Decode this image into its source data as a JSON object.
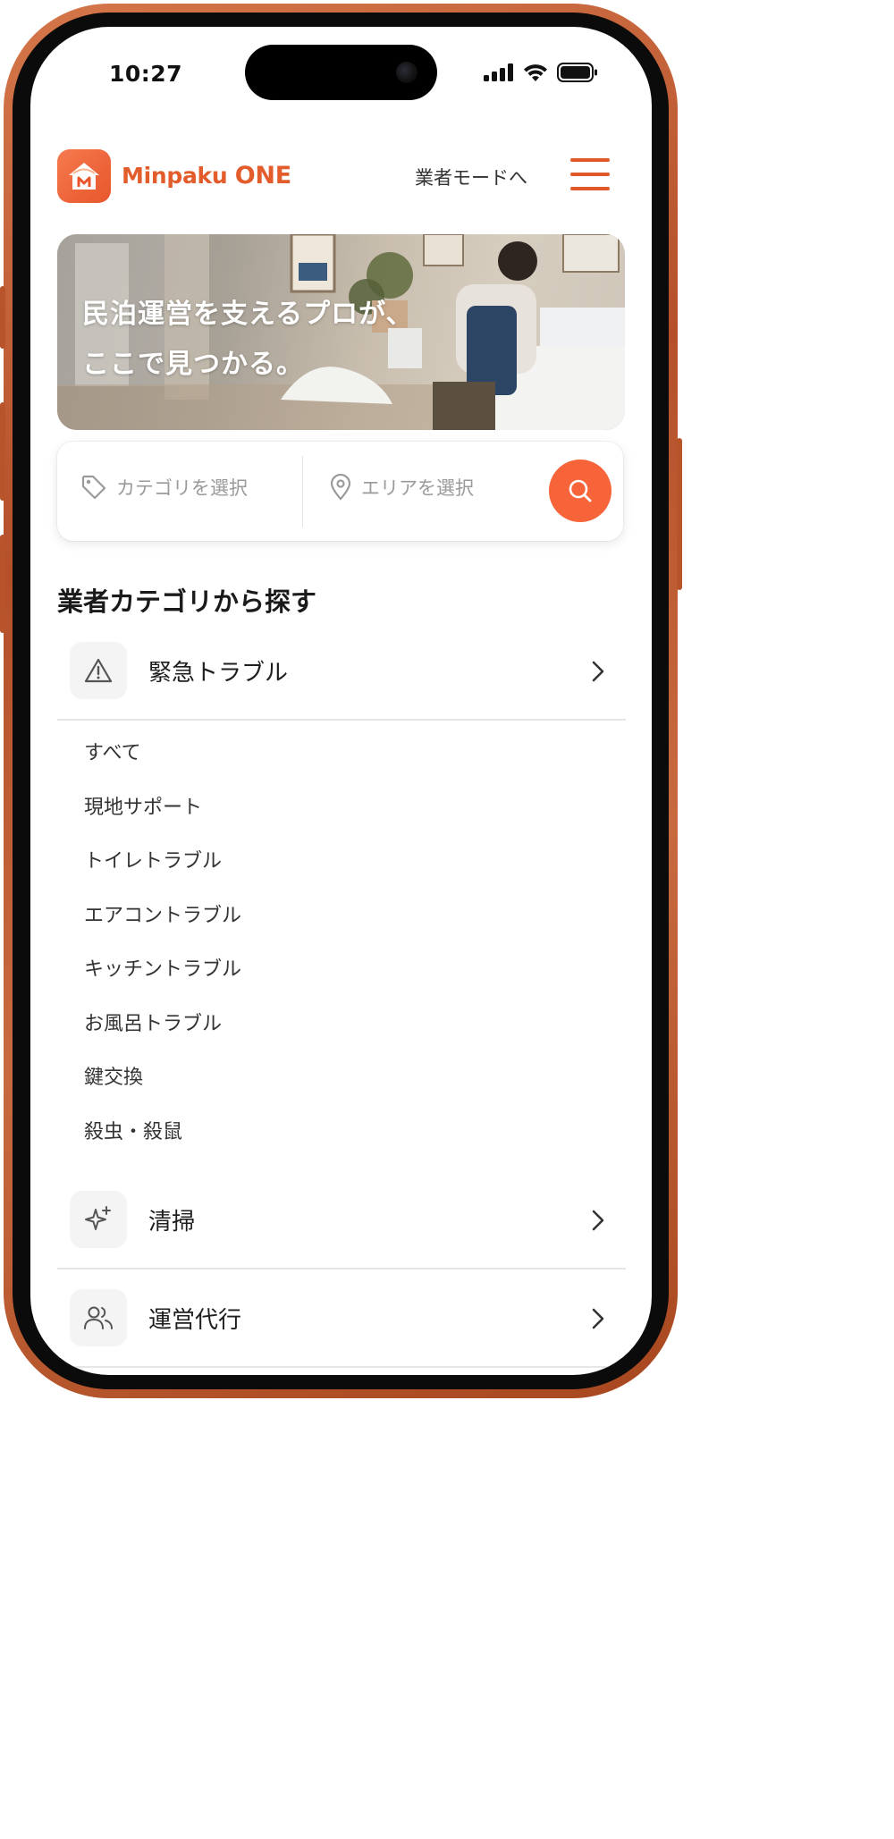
{
  "status_bar": {
    "time": "10:27"
  },
  "header": {
    "brand_part1": "Minpaku",
    "brand_part2": "ONE",
    "vendor_mode_link": "業者モードへ"
  },
  "hero": {
    "line1": "民泊運営を支えるプロが、",
    "line2": "ここで見つかる。"
  },
  "search": {
    "category_placeholder": "カテゴリを選択",
    "area_placeholder": "エリアを選択"
  },
  "section_title": "業者カテゴリから探す",
  "categories": [
    {
      "label": "緊急トラブル",
      "icon": "warning-triangle-icon",
      "expanded": true,
      "subcategories": [
        "すべて",
        "現地サポート",
        "トイレトラブル",
        "エアコントラブル",
        "キッチントラブル",
        "お風呂トラブル",
        "鍵交換",
        "殺虫・殺鼠"
      ]
    },
    {
      "label": "清掃",
      "icon": "sparkles-icon",
      "expanded": false
    },
    {
      "label": "運営代行",
      "icon": "users-icon",
      "expanded": false
    }
  ],
  "colors": {
    "brand": "#e8562c",
    "search_button": "#f7643a",
    "frame": "#b5502a"
  }
}
